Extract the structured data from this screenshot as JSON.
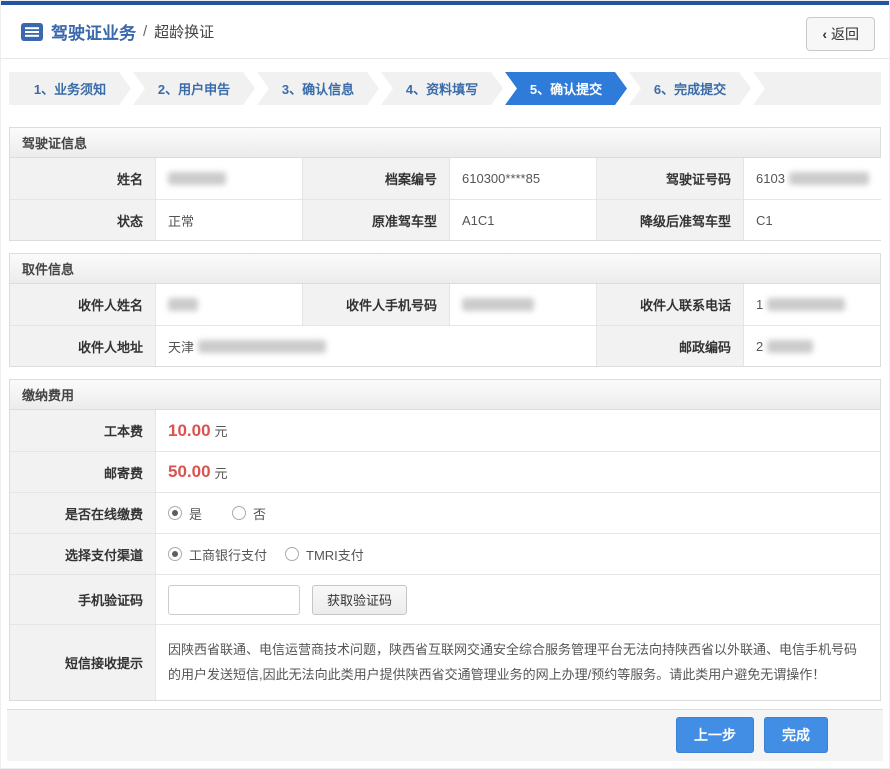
{
  "header": {
    "app_title": "驾驶证业务",
    "separator": "/",
    "page_title": "超龄换证",
    "back_chevron": "‹",
    "back_label": "返回"
  },
  "steps": [
    {
      "label": "1、业务须知"
    },
    {
      "label": "2、用户申告"
    },
    {
      "label": "3、确认信息"
    },
    {
      "label": "4、资料填写"
    },
    {
      "label": "5、确认提交"
    },
    {
      "label": "6、完成提交"
    }
  ],
  "license": {
    "title": "驾驶证信息",
    "name_label": "姓名",
    "archive_label": "档案编号",
    "archive_value": "610300****85",
    "license_no_label": "驾驶证号码",
    "license_no_prefix": "6103",
    "status_label": "状态",
    "status_value": "正常",
    "orig_class_label": "原准驾车型",
    "orig_class_value": "A1C1",
    "downgrade_class_label": "降级后准驾车型",
    "downgrade_class_value": "C1"
  },
  "pickup": {
    "title": "取件信息",
    "recipient_name_label": "收件人姓名",
    "recipient_mobile_label": "收件人手机号码",
    "recipient_phone_label": "收件人联系电话",
    "recipient_phone_prefix": "1",
    "address_label": "收件人地址",
    "address_prefix": "天津",
    "postcode_label": "邮政编码",
    "postcode_prefix": "2"
  },
  "fees": {
    "title": "缴纳费用",
    "work_fee_label": "工本费",
    "work_fee_value": "10.00",
    "postage_fee_label": "邮寄费",
    "postage_fee_value": "50.00",
    "unit": "元",
    "online_label": "是否在线缴费",
    "online_yes": "是",
    "online_no": "否",
    "channel_label": "选择支付渠道",
    "channel_icbc": "工商银行支付",
    "channel_tmri": "TMRI支付",
    "sms_label": "手机验证码",
    "get_code_label": "获取验证码",
    "notice_label": "短信接收提示",
    "notice_text": "因陕西省联通、电信运营商技术问题，陕西省互联网交通安全综合服务管理平台无法向持陕西省以外联通、电信手机号码的用户发送短信,因此无法向此类用户提供陕西省交通管理业务的网上办理/预约等服务。请此类用户避免无谓操作！"
  },
  "footer": {
    "prev_label": "上一步",
    "finish_label": "完成"
  },
  "colors": {
    "top_bar_blue": "#2155a3",
    "active_step_blue": "#2e7bd9",
    "step_text_blue": "#3a6ca9",
    "fee_red": "#d9534f",
    "notice_red": "#c9433c",
    "button_blue": "#418ee4"
  }
}
